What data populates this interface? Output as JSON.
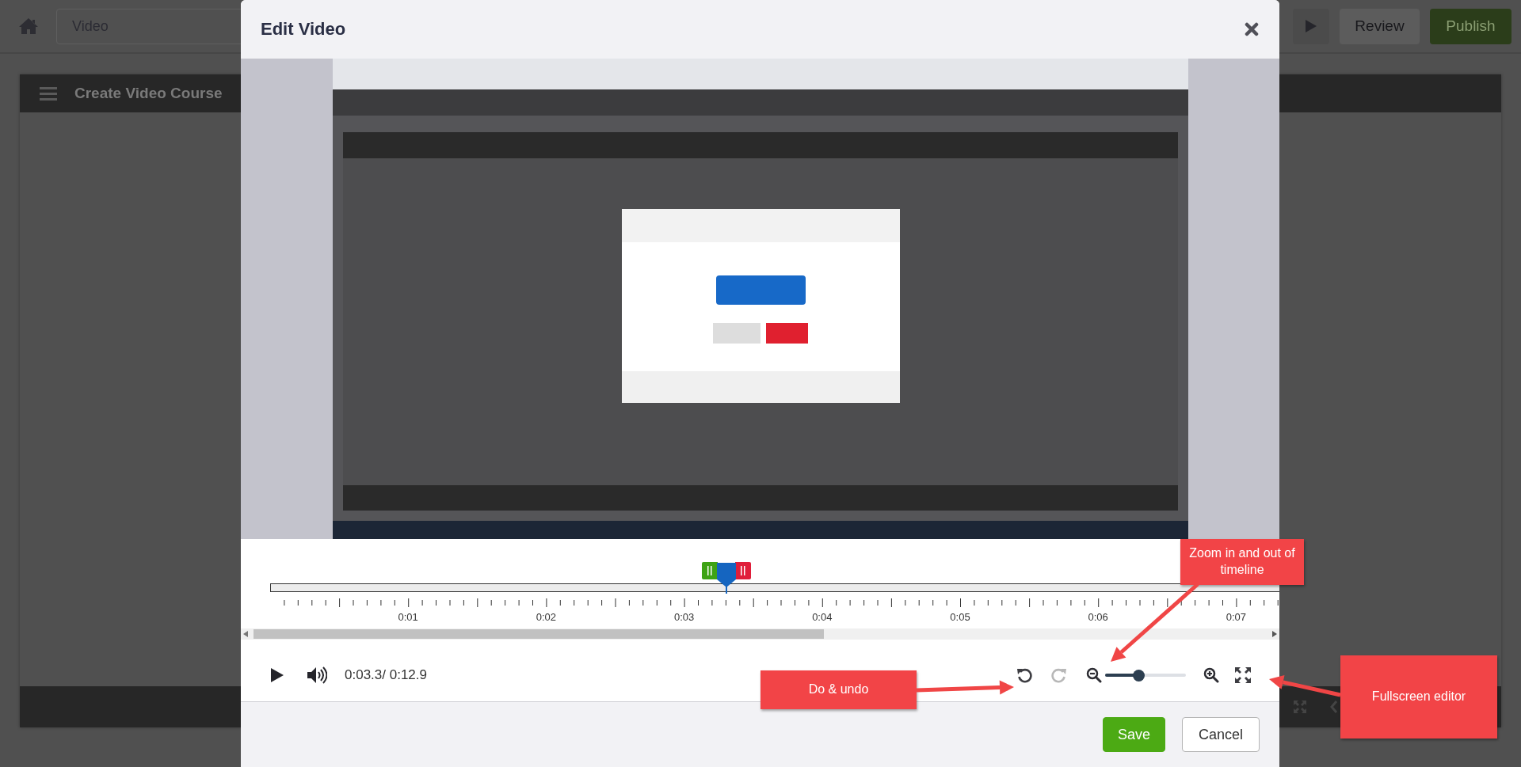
{
  "app_bar": {
    "course_type": "Video",
    "buttons": [
      {
        "kind": "play"
      },
      {
        "kind": "review",
        "label": "Review"
      },
      {
        "kind": "publish",
        "label": "Publish"
      }
    ]
  },
  "course_panel": {
    "title": "Create Video Course"
  },
  "dialog": {
    "title": "Edit Video",
    "timeline": {
      "playhead": {
        "level": 0.452
      },
      "tick_labels": [
        "0:01",
        "0:02",
        "0:03",
        "0:04",
        "0:05",
        "0:06",
        "0:07"
      ]
    },
    "controls": {
      "time": "0:03.3/ 0:12.9",
      "undo": {
        "disabled": false
      },
      "redo": {
        "disabled": true
      },
      "zoom": {
        "level": 0.41
      }
    },
    "buttons": [
      {
        "kind": "primary",
        "label": "Save"
      },
      {
        "kind": "secondary",
        "label": "Cancel"
      }
    ]
  },
  "annotations": [
    {
      "text": "Zoom in and out of timeline"
    },
    {
      "text": "Do & undo"
    },
    {
      "text": "Fullscreen editor"
    }
  ]
}
